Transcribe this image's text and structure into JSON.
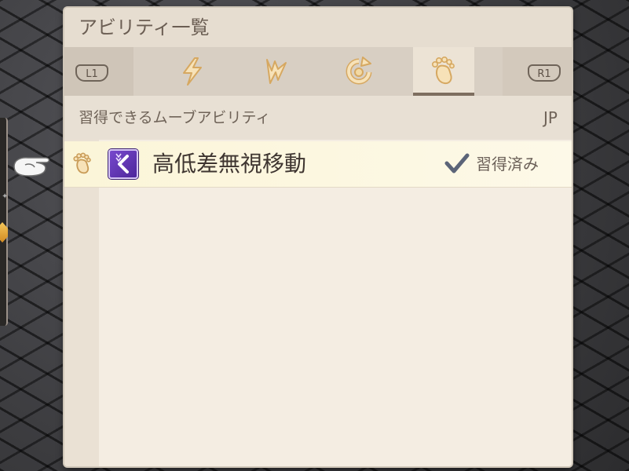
{
  "panel": {
    "title": "アビリティ一覧"
  },
  "tabs": {
    "left_shoulder": "L1",
    "right_shoulder": "R1",
    "items": [
      {
        "icon": "lightning-icon"
      },
      {
        "icon": "lightning-bolt-icon"
      },
      {
        "icon": "rotate-arrow-icon"
      },
      {
        "icon": "footprint-icon",
        "active": true
      }
    ]
  },
  "section": {
    "title": "習得できるムーブアビリティ",
    "cost_header": "JP"
  },
  "abilities": [
    {
      "icon": "high-ground-move-icon",
      "name": "高低差無視移動",
      "status": "習得済み",
      "learned": true
    }
  ],
  "colors": {
    "panel_bg": "#f3ece0",
    "accent": "#7d6e5f",
    "icon_purple": "#6a3cc0",
    "check": "#5b6478"
  }
}
